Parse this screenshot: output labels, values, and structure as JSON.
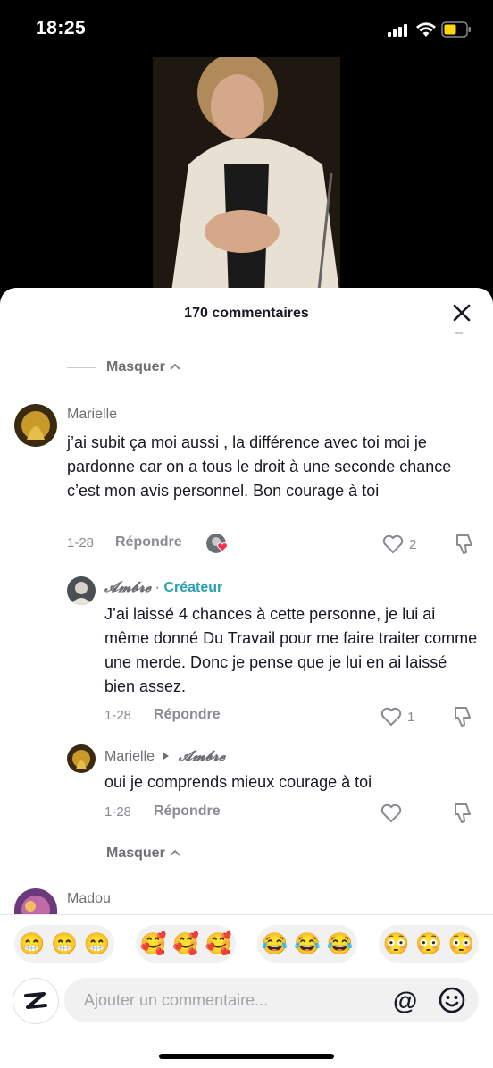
{
  "status_bar": {
    "time": "18:25"
  },
  "comments_panel": {
    "title": "170 commentaires",
    "hide_label": "Masquer",
    "hide_label_bottom": "Masquer"
  },
  "comments": [
    {
      "username": "Marielle",
      "text": "j’ai subit ça moi aussi , la différence avec toi moi je pardonne car on a tous le droit à une seconde chance c’est mon avis personnel. Bon courage à toi",
      "date": "1-28",
      "reply_label": "Répondre",
      "likes": "2"
    },
    {
      "username": "𝓐𝓶𝓫𝓻𝓮",
      "separator": "·",
      "badge": "Créateur",
      "text": "J’ai laissé 4 chances à cette personne, je lui ai même donné Du Travail pour me faire traiter comme une merde. Donc je pense que je lui en ai laissé bien assez.",
      "date": "1-28",
      "reply_label": "Répondre",
      "likes": "1"
    },
    {
      "username": "Marielle",
      "reply_to": "𝓐𝓶𝓫𝓻𝓮",
      "text": "oui je comprends mieux courage à toi",
      "date": "1-28",
      "reply_label": "Répondre",
      "likes": ""
    },
    {
      "username": "Madou"
    }
  ],
  "emoji_groups": [
    {
      "emojis": "😁 😁 😁"
    },
    {
      "emojis": "🥰 🥰 🥰"
    },
    {
      "emojis": "😂 😂 😂"
    },
    {
      "emojis": "😳 😳 😳"
    }
  ],
  "composer": {
    "placeholder": "Ajouter un commentaire...",
    "at_symbol": "@"
  },
  "colors": {
    "creator_badge": "#2aa1b6",
    "like_heart": "#fe2c55"
  }
}
